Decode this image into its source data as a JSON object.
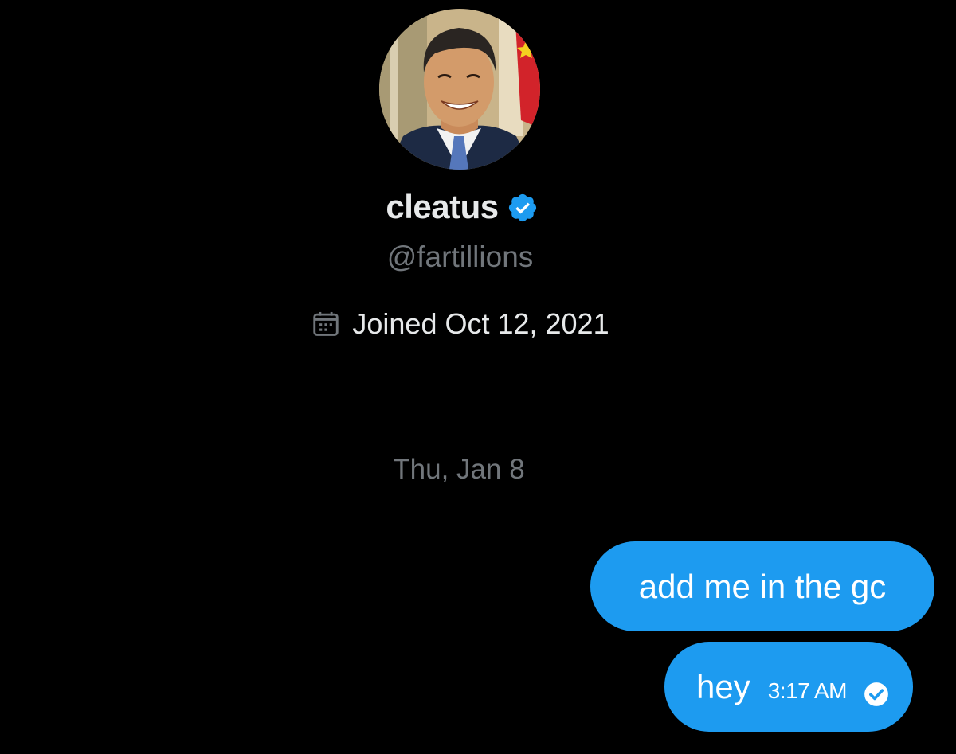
{
  "profile": {
    "name": "cleatus",
    "handle": "@fartillions",
    "joined": "Joined Oct 12, 2021",
    "avatar_icon": "avatar-photo",
    "verified_icon": "verified-badge-icon",
    "calendar_icon": "calendar-icon"
  },
  "conversation": {
    "date_divider": "Thu, Jan 8",
    "messages": [
      {
        "text": "add me in the gc"
      },
      {
        "text": "hey",
        "time": "3:17 AM",
        "status_icon": "read-check-icon"
      }
    ]
  },
  "colors": {
    "background": "#000000",
    "bubble": "#1d9bf0",
    "primary_text": "#e7e9ea",
    "secondary_text": "#71767b",
    "verified": "#1d9bf0"
  }
}
